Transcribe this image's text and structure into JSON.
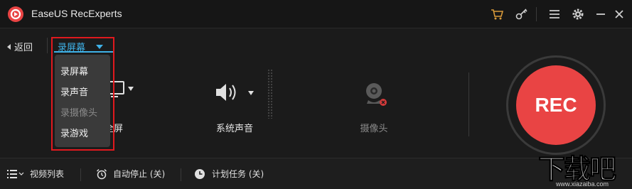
{
  "app": {
    "title": "EaseUS RecExperts"
  },
  "titlebar": {
    "icons": [
      "cart-icon",
      "key-icon",
      "menu-icon",
      "settings-icon",
      "minimize-icon",
      "close-icon"
    ]
  },
  "subbar": {
    "back_label": "返回",
    "mode_selected": "录屏幕"
  },
  "mode_menu": {
    "items": [
      {
        "label": "录屏幕",
        "enabled": true
      },
      {
        "label": "录声音",
        "enabled": true
      },
      {
        "label": "录摄像头",
        "enabled": false
      },
      {
        "label": "录游戏",
        "enabled": true
      }
    ]
  },
  "sources": {
    "screen_label": "全屏",
    "audio_label": "系统声音",
    "webcam_label": "摄像头"
  },
  "rec": {
    "label": "REC"
  },
  "bottombar": {
    "video_list": "视频列表",
    "auto_stop": "自动停止 (关)",
    "schedule": "计划任务 (关)"
  },
  "watermark": {
    "text": "下载吧",
    "url": "www.xiazaiba.com"
  },
  "colors": {
    "accent": "#3fb2e8",
    "rec": "#e94444",
    "highlight_box": "#e0191e",
    "background": "#1b1b1b"
  }
}
